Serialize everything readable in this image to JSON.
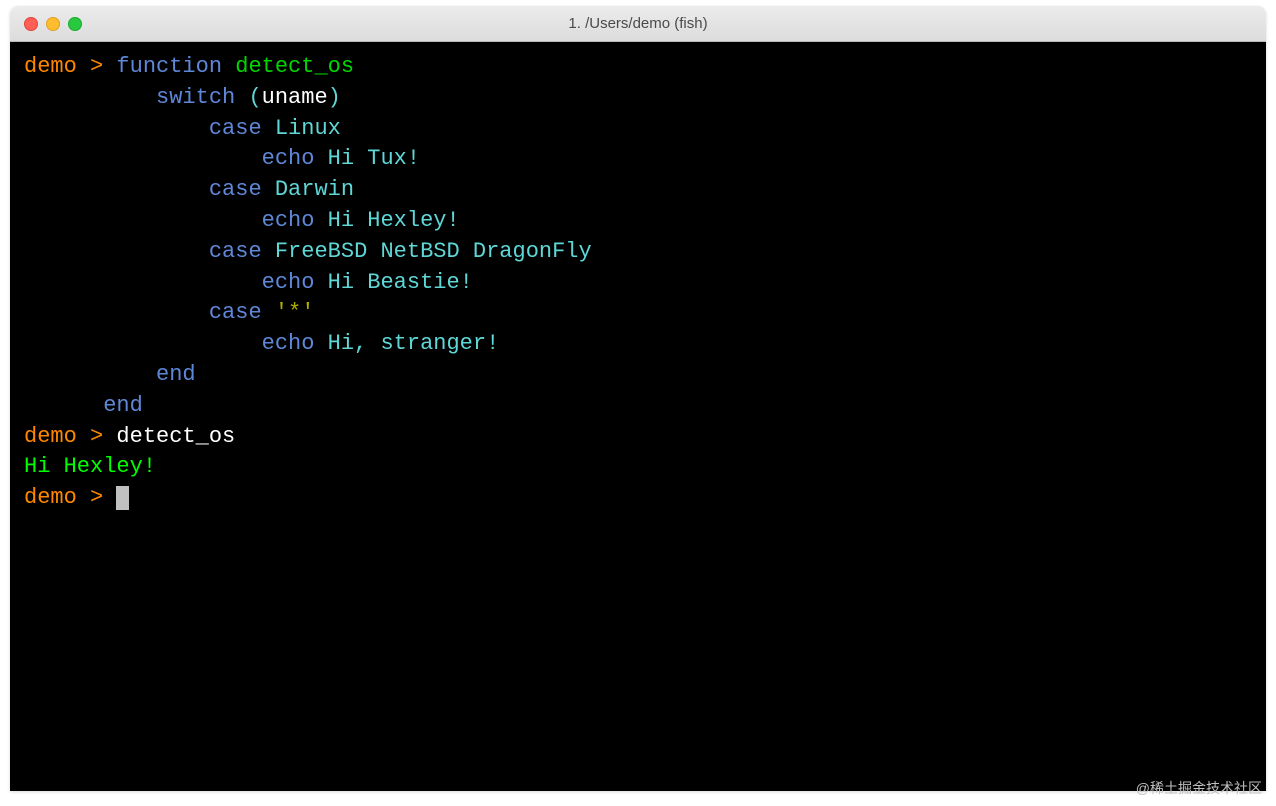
{
  "window": {
    "title": "1. /Users/demo (fish)"
  },
  "colors": {
    "prompt": "#ff8700",
    "keyword": "#5f87d7",
    "funcname": "#00d700",
    "argument": "#5fd7d7",
    "string": "#afaf00",
    "output_green": "#00ff00",
    "background": "#000000"
  },
  "prompt": {
    "user": "demo",
    "symbol": ">"
  },
  "code": {
    "l1_function": "function",
    "l1_name": "detect_os",
    "l2_switch": "switch",
    "l2_open": "(",
    "l2_cmd": "uname",
    "l2_close": ")",
    "l3_case": "case",
    "l3_arg": "Linux",
    "l4_echo": "echo",
    "l4_text": "Hi Tux!",
    "l5_case": "case",
    "l5_arg": "Darwin",
    "l6_echo": "echo",
    "l6_text": "Hi Hexley!",
    "l7_case": "case",
    "l7_arg": "FreeBSD NetBSD DragonFly",
    "l8_echo": "echo",
    "l8_text": "Hi Beastie!",
    "l9_case": "case",
    "l9_arg": "'*'",
    "l10_echo": "echo",
    "l10_text": "Hi, stranger!",
    "l11_end": "end",
    "l12_end": "end"
  },
  "exec": {
    "cmd": "detect_os",
    "output": "Hi Hexley!"
  },
  "watermark": "@稀土掘金技术社区"
}
